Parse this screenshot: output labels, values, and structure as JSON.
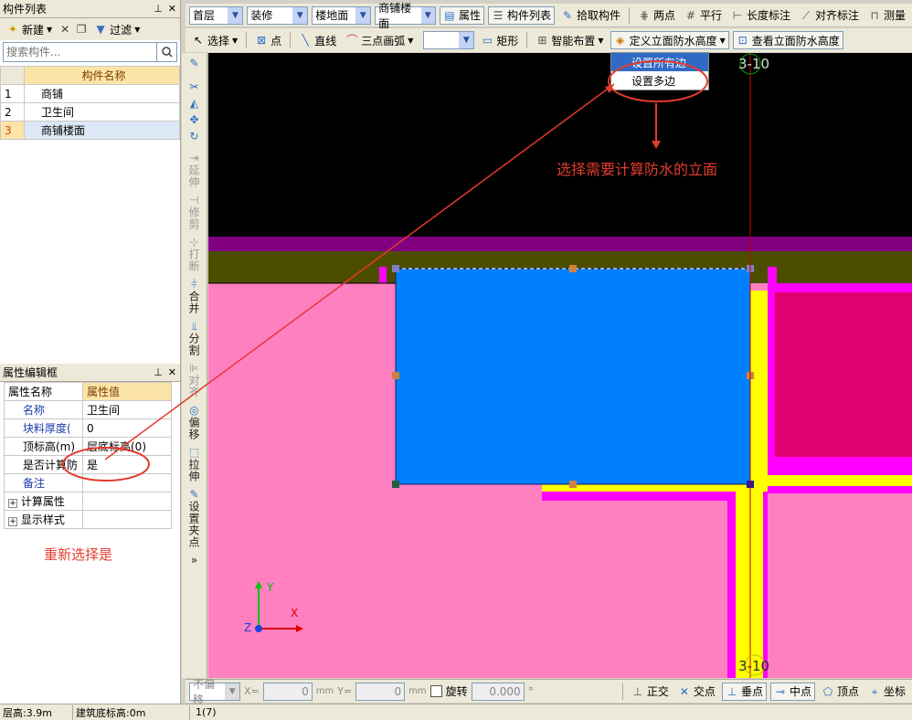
{
  "left_panel": {
    "title": "构件列表",
    "toolbar": {
      "new_label": "新建",
      "filter_label": "过滤"
    },
    "search_placeholder": "搜索构件...",
    "table_header": "构件名称",
    "rows": [
      {
        "num": "1",
        "name": "商铺"
      },
      {
        "num": "2",
        "name": "卫生间"
      },
      {
        "num": "3",
        "name": "商铺楼面"
      }
    ]
  },
  "prop_panel": {
    "title": "属性编辑框",
    "col_name": "属性名称",
    "col_value": "属性值",
    "rows": [
      {
        "name": "名称",
        "value": "卫生间"
      },
      {
        "name": "块料厚度(",
        "value": "0"
      },
      {
        "name": "顶标高(m)",
        "value": "层底标高(0)"
      },
      {
        "name": "是否计算防",
        "value": "是"
      },
      {
        "name": "备注",
        "value": ""
      },
      {
        "name": "计算属性",
        "value": ""
      },
      {
        "name": "显示样式",
        "value": ""
      }
    ],
    "annotation": "重新选择是"
  },
  "toolbar1": {
    "floor": "首层",
    "category": "装修",
    "type": "楼地面",
    "component": "商铺楼面",
    "properties": "属性",
    "component_list": "构件列表",
    "pick": "拾取构件",
    "two_points": "两点",
    "parallel": "平行",
    "length_dim": "长度标注",
    "align_dim": "对齐标注",
    "measure": "测量"
  },
  "toolbar2": {
    "select": "选择",
    "point": "点",
    "line": "直线",
    "arc": "三点画弧",
    "rect": "矩形",
    "smart_layout": "智能布置",
    "define_height": "定义立面防水高度",
    "view_height": "查看立面防水高度"
  },
  "dropdown_menu": {
    "items": [
      "设置所有边",
      "设置多边"
    ]
  },
  "canvas": {
    "axis_top": "3-10",
    "axis_bottom": "3-10",
    "annotation": "选择需要计算防水的立面",
    "axis_y": "Y",
    "axis_x": "X",
    "axis_z": "Z"
  },
  "vertical_tools": [
    "延伸",
    "修剪",
    "打断",
    "合并",
    "分割",
    "对齐",
    "偏移",
    "拉伸",
    "设置夹点"
  ],
  "bottom_bar": {
    "offset": "不偏移",
    "x_label": "X=",
    "x_value": "0",
    "y_label": "Y=",
    "y_value": "0",
    "unit": "mm",
    "rotate": "旋转",
    "rotate_value": "0.000",
    "degree": "°",
    "ortho": "正交",
    "intersect": "交点",
    "perpendicular": "垂点",
    "midpoint": "中点",
    "vertex": "顶点",
    "coord": "坐标"
  },
  "status_bar": {
    "floor_height": "层高:3.9m",
    "base_elevation": "建筑底标高:0m",
    "count": "1(7)"
  },
  "colors": {
    "canvas_black": "#000000",
    "purple_band": "#800080",
    "olive_band": "#4d4d00",
    "pink": "#ff80c0",
    "magenta": "#ff00ff",
    "blue_slab": "#0080ff",
    "yellow": "#ffff00",
    "annotation_red": "#e23b2e",
    "menu_highlight": "#316ac5"
  }
}
